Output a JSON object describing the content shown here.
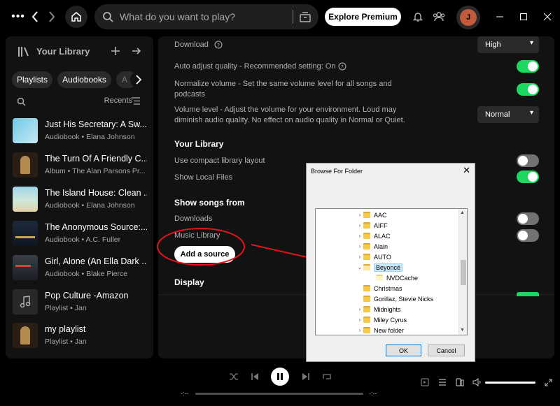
{
  "topbar": {
    "search_placeholder": "What do you want to play?",
    "explore_label": "Explore Premium",
    "avatar_initial": "J"
  },
  "sidebar": {
    "title": "Your Library",
    "filters": [
      "Playlists",
      "Audiobooks",
      "A"
    ],
    "sort_label": "Recents",
    "items": [
      {
        "title": "Just His Secretary: A Sw...",
        "subtitle": "Audiobook • Elana Johnson"
      },
      {
        "title": "The Turn Of A Friendly C...",
        "subtitle": "Album • The Alan Parsons Pr..."
      },
      {
        "title": "The Island House: Clean ...",
        "subtitle": "Audiobook • Elana Johnson"
      },
      {
        "title": "The Anonymous Source:...",
        "subtitle": "Audiobook • A.C. Fuller"
      },
      {
        "title": "Girl, Alone (An Ella Dark ...",
        "subtitle": "Audiobook • Blake Pierce"
      },
      {
        "title": "Pop Culture -Amazon",
        "subtitle": "Playlist • Jan"
      },
      {
        "title": "my playlist",
        "subtitle": "Playlist • Jan"
      }
    ]
  },
  "settings": {
    "download_label": "Download",
    "download_value": "High",
    "auto_adjust_label": "Auto adjust quality - Recommended setting: On",
    "normalize_label_1": "Normalize volume - Set the same volume level for all songs and",
    "normalize_label_2": "podcasts",
    "volume_level_label_1": "Volume level - Adjust the volume for your environment. Loud may",
    "volume_level_label_2": "diminish audio quality. No effect on audio quality in Normal or Quiet.",
    "volume_level_value": "Normal",
    "your_library_heading": "Your Library",
    "compact_label": "Use compact library layout",
    "local_files_label": "Show Local Files",
    "show_songs_heading": "Show songs from",
    "downloads_label": "Downloads",
    "music_library_label": "Music Library",
    "add_source_label": "Add a source",
    "display_heading": "Display"
  },
  "dialog": {
    "title": "Browse For Folder",
    "folders": [
      {
        "name": "AAC",
        "expandable": true,
        "selected": false
      },
      {
        "name": "AIFF",
        "expandable": true,
        "selected": false
      },
      {
        "name": "ALAC",
        "expandable": true,
        "selected": false
      },
      {
        "name": "Alain",
        "expandable": true,
        "selected": false
      },
      {
        "name": "AUTO",
        "expandable": true,
        "selected": false
      },
      {
        "name": "Beyoncé",
        "expandable": true,
        "selected": true
      },
      {
        "name": "NVDCache",
        "expandable": false,
        "selected": false
      },
      {
        "name": "Christmas",
        "expandable": false,
        "selected": false
      },
      {
        "name": "Gorillaz, Stevie Nicks",
        "expandable": false,
        "selected": false
      },
      {
        "name": "Midnights",
        "expandable": true,
        "selected": false
      },
      {
        "name": "Miley Cyrus",
        "expandable": true,
        "selected": false
      },
      {
        "name": "New folder",
        "expandable": true,
        "selected": false
      }
    ],
    "ok_label": "OK",
    "cancel_label": "Cancel"
  },
  "player": {
    "elapsed": "-:--",
    "remaining": "-:--"
  },
  "colors": {
    "accent": "#1ed760",
    "annotation": "#e3141c"
  }
}
